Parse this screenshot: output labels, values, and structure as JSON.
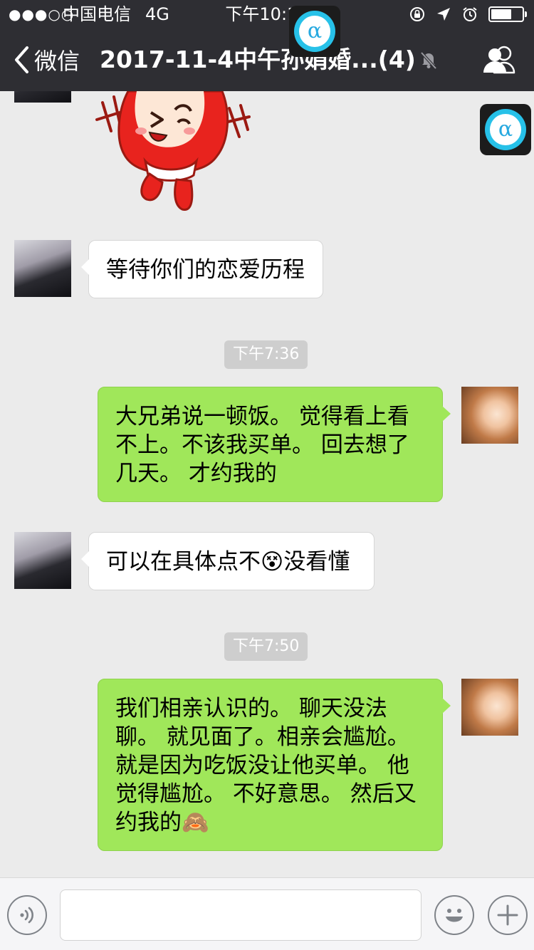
{
  "status_bar": {
    "signal": "●●●○○",
    "carrier": "中国电信",
    "network": "4G",
    "time": "下午10:17"
  },
  "nav": {
    "back_label": "微信",
    "title": "2017-11-4中午孙娟婚...(4)"
  },
  "floating_ball": {
    "glyph": "α"
  },
  "messages": [
    {
      "type": "sticker",
      "sender": "other",
      "icon": "red-cartoon-sticker"
    },
    {
      "type": "text",
      "sender": "other",
      "text": "等待你们的恋爱历程"
    },
    {
      "type": "time",
      "text": "下午7:36"
    },
    {
      "type": "text",
      "sender": "me",
      "text": "大兄弟说一顿饭。  觉得看上看不上。不该我买单。 回去想了几天。 才约我的"
    },
    {
      "type": "text",
      "sender": "other",
      "text": "可以在具体点不😵没看懂"
    },
    {
      "type": "time",
      "text": "下午7:50"
    },
    {
      "type": "text",
      "sender": "me",
      "text": "我们相亲认识的。 聊天没法聊。  就见面了。相亲会尴尬。 就是因为吃饭没让他买单。 他觉得尴尬。 不好意思。 然后又约我的🙈"
    }
  ],
  "input_bar": {
    "voice_icon": "voice-icon",
    "emoji_icon": "emoji-icon",
    "plus_icon": "plus-icon",
    "text_value": ""
  },
  "colors": {
    "header_bg": "#2e2e33",
    "chat_bg": "#ebebeb",
    "bubble_me": "#a0e75a",
    "bubble_other": "#ffffff",
    "time_pill": "#cecece"
  }
}
